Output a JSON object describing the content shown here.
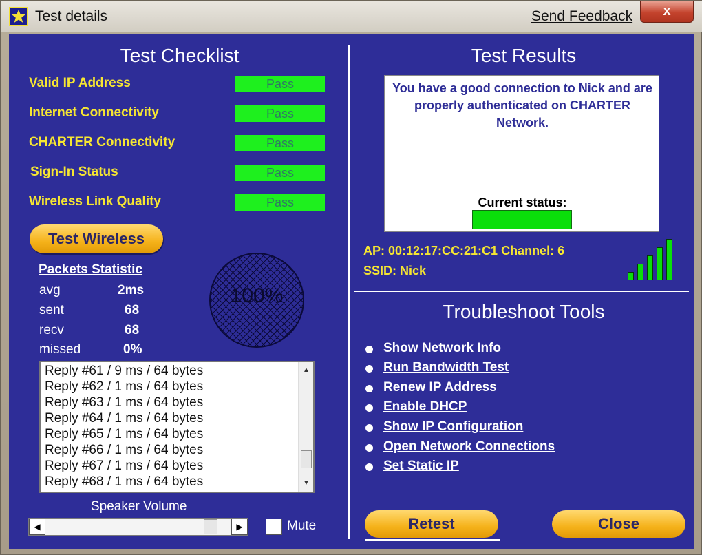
{
  "window": {
    "title": "Test details",
    "send_feedback": "Send Feedback",
    "close_glyph": "x"
  },
  "checklist": {
    "title": "Test Checklist",
    "items": [
      {
        "label": "Valid IP Address",
        "status": "Pass"
      },
      {
        "label": "Internet Connectivity",
        "status": "Pass"
      },
      {
        "label": "CHARTER Connectivity",
        "status": "Pass"
      },
      {
        "label": "Sign-In Status",
        "status": "Pass"
      },
      {
        "label": "Wireless Link Quality",
        "status": "Pass"
      }
    ],
    "test_wireless_button": "Test Wireless"
  },
  "packets": {
    "heading": "Packets Statistic",
    "rows": [
      {
        "label": "avg",
        "value": "2ms"
      },
      {
        "label": "sent",
        "value": "68"
      },
      {
        "label": "recv",
        "value": "68"
      },
      {
        "label": "missed",
        "value": "0%"
      }
    ],
    "gauge_text": "100%",
    "replies": [
      "Reply #61 / 9 ms / 64 bytes",
      "Reply #62 / 1 ms / 64 bytes",
      "Reply #63 / 1 ms / 64 bytes",
      "Reply #64 / 1 ms / 64 bytes",
      "Reply #65 / 1 ms / 64 bytes",
      "Reply #66 / 1 ms / 64 bytes",
      "Reply #67 / 1 ms / 64 bytes",
      "Reply #68 / 1 ms / 64 bytes"
    ]
  },
  "speaker": {
    "label": "Speaker Volume",
    "volume_fraction": 0.92,
    "mute_label": "Mute",
    "muted": false
  },
  "results": {
    "title": "Test Results",
    "message": "You have a good connection to Nick and are properly authenticated on CHARTER Network.",
    "current_status_label": "Current status:",
    "status_color": "#0adf0a",
    "ap": "AP: 00:12:17:CC:21:C1  Channel: 6",
    "ssid": "SSID: Nick",
    "signal_bars": 5
  },
  "tools": {
    "title": "Troubleshoot Tools",
    "links": [
      "Show Network Info",
      "Run Bandwidth Test",
      "Renew IP Address",
      "Enable DHCP",
      "Show IP Configuration",
      "Open Network Connections",
      "Set Static IP"
    ]
  },
  "buttons": {
    "retest": "Retest",
    "close": "Close"
  },
  "colors": {
    "panel": "#2e2d98",
    "label_yellow": "#f6e632",
    "pass_green": "#1ef01e",
    "button_orange": "#f5b21a"
  }
}
